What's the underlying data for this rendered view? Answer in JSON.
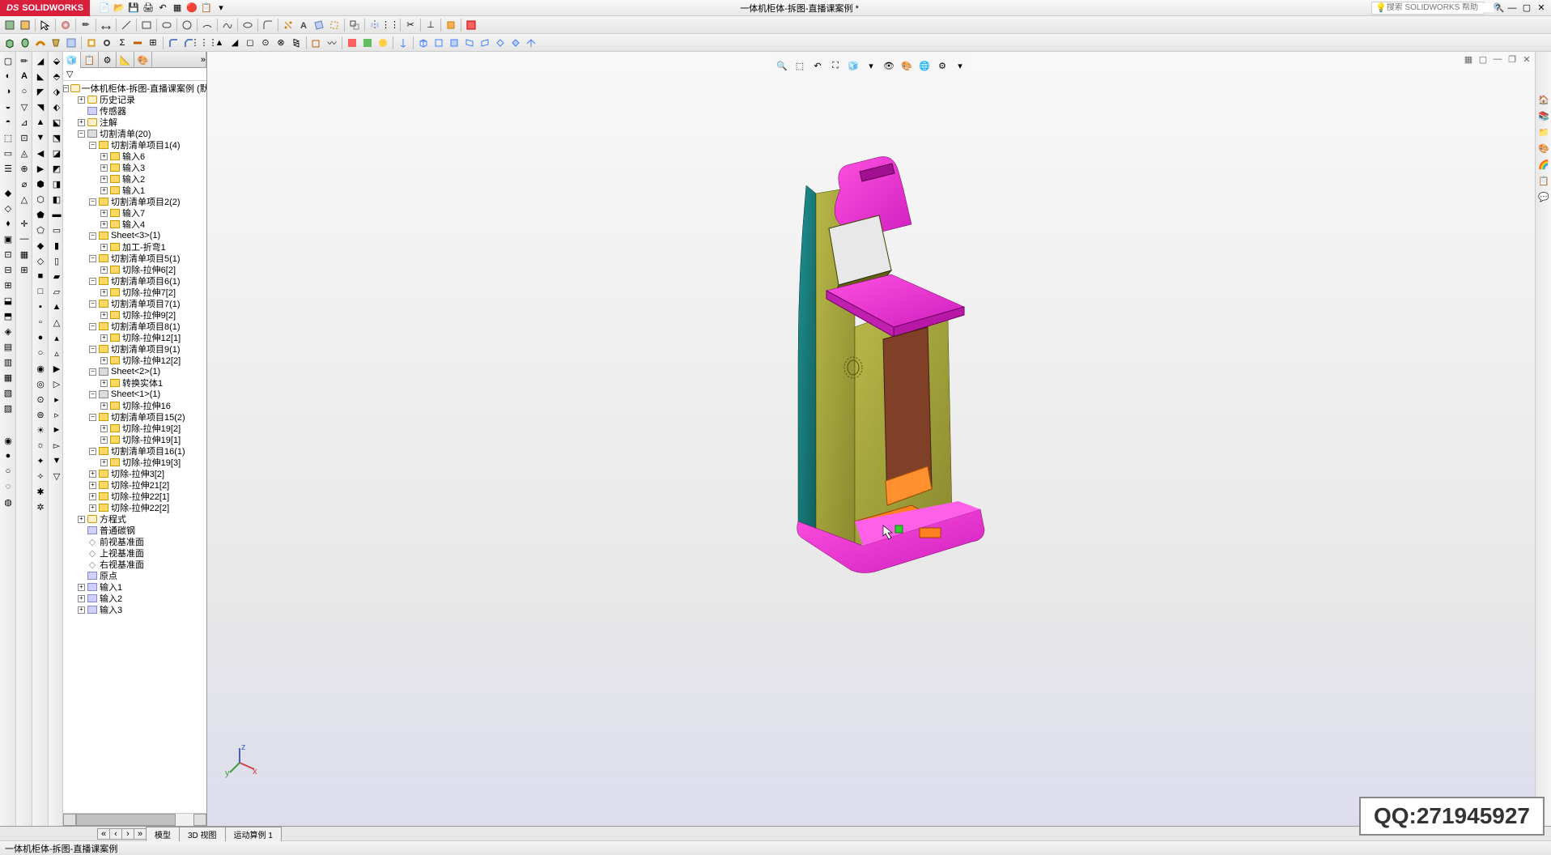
{
  "app": {
    "name": "SOLIDWORKS"
  },
  "title": "一体机柜体-拆图-直播课案例 *",
  "search": {
    "icon_label": "搜索",
    "placeholder": "搜索 SOLIDWORKS 帮助"
  },
  "statusbar": {
    "doc": "一体机柜体-拆图-直播课案例"
  },
  "bottom_tabs": [
    "模型",
    "3D 视图",
    "运动算例 1"
  ],
  "watermark": "QQ:271945927",
  "tree": {
    "root": "一体机柜体-拆图-直播课案例 (默",
    "items": [
      {
        "d": 1,
        "exp": "+",
        "ico": "part",
        "t": "历史记录"
      },
      {
        "d": 1,
        "exp": "",
        "ico": "feature",
        "t": "传感器"
      },
      {
        "d": 1,
        "exp": "+",
        "ico": "part",
        "t": "注解"
      },
      {
        "d": 1,
        "exp": "-",
        "ico": "sheet",
        "t": "切割清单(20)"
      },
      {
        "d": 2,
        "exp": "-",
        "ico": "folder",
        "t": "切割清单项目1(4)"
      },
      {
        "d": 3,
        "exp": "+",
        "ico": "folder",
        "t": "输入6"
      },
      {
        "d": 3,
        "exp": "+",
        "ico": "folder",
        "t": "输入3"
      },
      {
        "d": 3,
        "exp": "+",
        "ico": "folder",
        "t": "输入2"
      },
      {
        "d": 3,
        "exp": "+",
        "ico": "folder",
        "t": "输入1"
      },
      {
        "d": 2,
        "exp": "-",
        "ico": "folder",
        "t": "切割清单项目2(2)"
      },
      {
        "d": 3,
        "exp": "+",
        "ico": "folder",
        "t": "输入7"
      },
      {
        "d": 3,
        "exp": "+",
        "ico": "folder",
        "t": "输入4"
      },
      {
        "d": 2,
        "exp": "-",
        "ico": "folder",
        "t": "Sheet<3>(1)"
      },
      {
        "d": 3,
        "exp": "+",
        "ico": "folder",
        "t": "加工-折弯1"
      },
      {
        "d": 2,
        "exp": "-",
        "ico": "folder",
        "t": "切割清单项目5(1)"
      },
      {
        "d": 3,
        "exp": "+",
        "ico": "folder",
        "t": "切除-拉伸6[2]"
      },
      {
        "d": 2,
        "exp": "-",
        "ico": "folder",
        "t": "切割清单项目6(1)"
      },
      {
        "d": 3,
        "exp": "+",
        "ico": "folder",
        "t": "切除-拉伸7[2]"
      },
      {
        "d": 2,
        "exp": "-",
        "ico": "folder",
        "t": "切割清单项目7(1)"
      },
      {
        "d": 3,
        "exp": "+",
        "ico": "folder",
        "t": "切除-拉伸9[2]"
      },
      {
        "d": 2,
        "exp": "-",
        "ico": "folder",
        "t": "切割清单项目8(1)"
      },
      {
        "d": 3,
        "exp": "+",
        "ico": "folder",
        "t": "切除-拉伸12[1]"
      },
      {
        "d": 2,
        "exp": "-",
        "ico": "folder",
        "t": "切割清单项目9(1)"
      },
      {
        "d": 3,
        "exp": "+",
        "ico": "folder",
        "t": "切除-拉伸12[2]"
      },
      {
        "d": 2,
        "exp": "-",
        "ico": "sheet",
        "t": "Sheet<2>(1)"
      },
      {
        "d": 3,
        "exp": "+",
        "ico": "folder",
        "t": "转换实体1"
      },
      {
        "d": 2,
        "exp": "-",
        "ico": "sheet",
        "t": "Sheet<1>(1)"
      },
      {
        "d": 3,
        "exp": "+",
        "ico": "folder",
        "t": "切除-拉伸16"
      },
      {
        "d": 2,
        "exp": "-",
        "ico": "folder",
        "t": "切割清单项目15(2)"
      },
      {
        "d": 3,
        "exp": "+",
        "ico": "folder",
        "t": "切除-拉伸19[2]"
      },
      {
        "d": 3,
        "exp": "+",
        "ico": "folder",
        "t": "切除-拉伸19[1]"
      },
      {
        "d": 2,
        "exp": "-",
        "ico": "folder",
        "t": "切割清单项目16(1)"
      },
      {
        "d": 3,
        "exp": "+",
        "ico": "folder",
        "t": "切除-拉伸19[3]"
      },
      {
        "d": 2,
        "exp": "+",
        "ico": "folder",
        "t": "切除-拉伸3[2]"
      },
      {
        "d": 2,
        "exp": "+",
        "ico": "folder",
        "t": "切除-拉伸21[2]"
      },
      {
        "d": 2,
        "exp": "+",
        "ico": "folder",
        "t": "切除-拉伸22[1]"
      },
      {
        "d": 2,
        "exp": "+",
        "ico": "folder",
        "t": "切除-拉伸22[2]"
      },
      {
        "d": 1,
        "exp": "+",
        "ico": "part",
        "t": "方程式"
      },
      {
        "d": 1,
        "exp": "",
        "ico": "feature",
        "t": "普通碳钢"
      },
      {
        "d": 1,
        "exp": "",
        "ico": "plane",
        "t": "前视基准面"
      },
      {
        "d": 1,
        "exp": "",
        "ico": "plane",
        "t": "上视基准面"
      },
      {
        "d": 1,
        "exp": "",
        "ico": "plane",
        "t": "右视基准面"
      },
      {
        "d": 1,
        "exp": "",
        "ico": "feature",
        "t": "原点"
      },
      {
        "d": 1,
        "exp": "+",
        "ico": "feature",
        "t": "输入1"
      },
      {
        "d": 1,
        "exp": "+",
        "ico": "feature",
        "t": "输入2"
      },
      {
        "d": 1,
        "exp": "+",
        "ico": "feature",
        "t": "输入3"
      }
    ]
  }
}
